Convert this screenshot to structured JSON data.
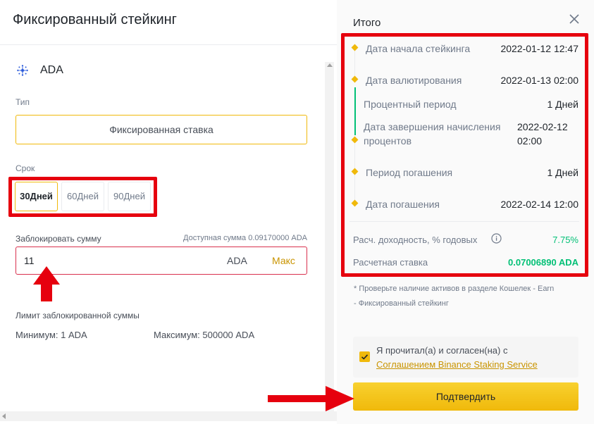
{
  "left": {
    "title": "Фиксированный стейкинг",
    "asset": "ADA",
    "type_label": "Тип",
    "type_value": "Фиксированная ставка",
    "term_label": "Срок",
    "terms": [
      "30Дней",
      "60Дней",
      "90Дней"
    ],
    "lock_label": "Заблокировать сумму",
    "available": "Доступная сумма 0.09170000 ADA",
    "amount_value": "11",
    "amount_unit": "ADA",
    "max_label": "Макс",
    "limit_label": "Лимит заблокированной суммы",
    "minimum": "Минимум: 1 ADA",
    "maximum": "Максимум: 500000 ADA"
  },
  "summary": {
    "title": "Итого",
    "rows": [
      {
        "label": "Дата начала стейкинга",
        "value": "2022-01-12 12:47"
      },
      {
        "label": "Дата валютирования",
        "value": "2022-01-13 02:00"
      },
      {
        "label": "Процентный период",
        "value": "1 Дней"
      },
      {
        "label_line1": "Дата завершения начисления",
        "label_line2": "процентов",
        "value_line1": "2022-02-12",
        "value_line2": "02:00"
      },
      {
        "label": "Период погашения",
        "value": "1 Дней"
      },
      {
        "label": "Дата погашения",
        "value": "2022-02-14 12:00"
      }
    ],
    "apy_label": "Расч. доходность, % годовых",
    "apy_value": "7.75%",
    "rate_label": "Расчетная ставка",
    "rate_value": "0.07006890 ADA",
    "note_line1": "* Проверьте наличие активов в разделе Кошелек - Earn",
    "note_line2": "- Фиксированный стейкинг",
    "agree_text": "Я прочитал(а) и согласен(на) с",
    "agree_link": "Соглашением Binance Staking Service",
    "confirm_label": "Подтвердить",
    "accent_green": "#02c076",
    "accent_yellow": "#f0b90b",
    "highlight_red": "#e6000e"
  }
}
